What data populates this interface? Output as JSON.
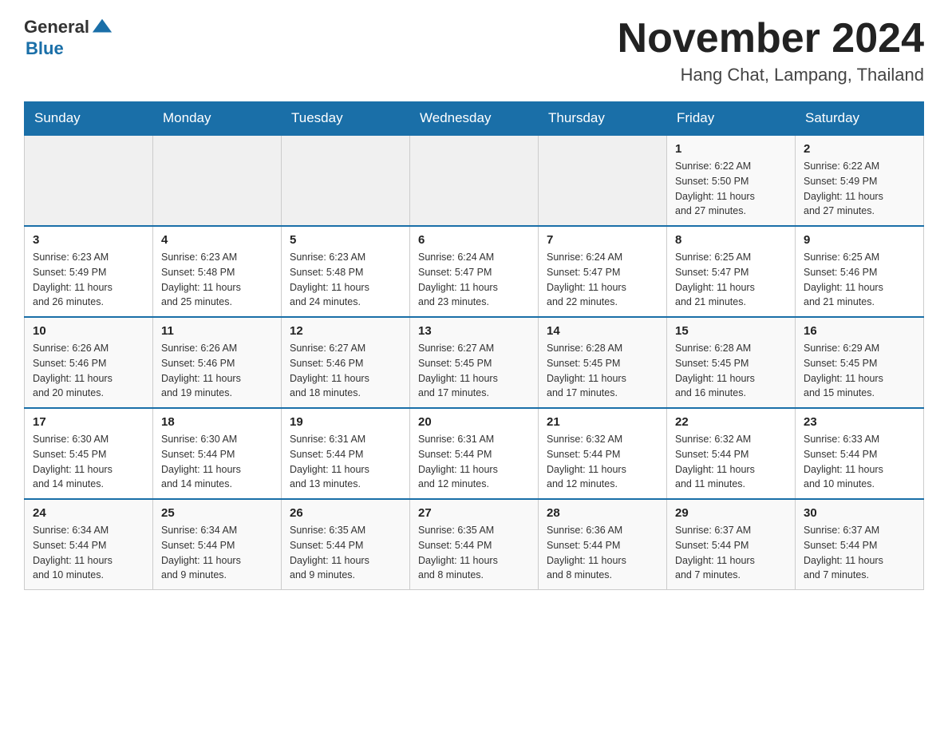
{
  "header": {
    "logo_text_general": "General",
    "logo_text_blue": "Blue",
    "month_title": "November 2024",
    "location": "Hang Chat, Lampang, Thailand"
  },
  "weekdays": [
    "Sunday",
    "Monday",
    "Tuesday",
    "Wednesday",
    "Thursday",
    "Friday",
    "Saturday"
  ],
  "weeks": [
    {
      "days": [
        {
          "num": "",
          "info": ""
        },
        {
          "num": "",
          "info": ""
        },
        {
          "num": "",
          "info": ""
        },
        {
          "num": "",
          "info": ""
        },
        {
          "num": "",
          "info": ""
        },
        {
          "num": "1",
          "info": "Sunrise: 6:22 AM\nSunset: 5:50 PM\nDaylight: 11 hours\nand 27 minutes."
        },
        {
          "num": "2",
          "info": "Sunrise: 6:22 AM\nSunset: 5:49 PM\nDaylight: 11 hours\nand 27 minutes."
        }
      ]
    },
    {
      "days": [
        {
          "num": "3",
          "info": "Sunrise: 6:23 AM\nSunset: 5:49 PM\nDaylight: 11 hours\nand 26 minutes."
        },
        {
          "num": "4",
          "info": "Sunrise: 6:23 AM\nSunset: 5:48 PM\nDaylight: 11 hours\nand 25 minutes."
        },
        {
          "num": "5",
          "info": "Sunrise: 6:23 AM\nSunset: 5:48 PM\nDaylight: 11 hours\nand 24 minutes."
        },
        {
          "num": "6",
          "info": "Sunrise: 6:24 AM\nSunset: 5:47 PM\nDaylight: 11 hours\nand 23 minutes."
        },
        {
          "num": "7",
          "info": "Sunrise: 6:24 AM\nSunset: 5:47 PM\nDaylight: 11 hours\nand 22 minutes."
        },
        {
          "num": "8",
          "info": "Sunrise: 6:25 AM\nSunset: 5:47 PM\nDaylight: 11 hours\nand 21 minutes."
        },
        {
          "num": "9",
          "info": "Sunrise: 6:25 AM\nSunset: 5:46 PM\nDaylight: 11 hours\nand 21 minutes."
        }
      ]
    },
    {
      "days": [
        {
          "num": "10",
          "info": "Sunrise: 6:26 AM\nSunset: 5:46 PM\nDaylight: 11 hours\nand 20 minutes."
        },
        {
          "num": "11",
          "info": "Sunrise: 6:26 AM\nSunset: 5:46 PM\nDaylight: 11 hours\nand 19 minutes."
        },
        {
          "num": "12",
          "info": "Sunrise: 6:27 AM\nSunset: 5:46 PM\nDaylight: 11 hours\nand 18 minutes."
        },
        {
          "num": "13",
          "info": "Sunrise: 6:27 AM\nSunset: 5:45 PM\nDaylight: 11 hours\nand 17 minutes."
        },
        {
          "num": "14",
          "info": "Sunrise: 6:28 AM\nSunset: 5:45 PM\nDaylight: 11 hours\nand 17 minutes."
        },
        {
          "num": "15",
          "info": "Sunrise: 6:28 AM\nSunset: 5:45 PM\nDaylight: 11 hours\nand 16 minutes."
        },
        {
          "num": "16",
          "info": "Sunrise: 6:29 AM\nSunset: 5:45 PM\nDaylight: 11 hours\nand 15 minutes."
        }
      ]
    },
    {
      "days": [
        {
          "num": "17",
          "info": "Sunrise: 6:30 AM\nSunset: 5:45 PM\nDaylight: 11 hours\nand 14 minutes."
        },
        {
          "num": "18",
          "info": "Sunrise: 6:30 AM\nSunset: 5:44 PM\nDaylight: 11 hours\nand 14 minutes."
        },
        {
          "num": "19",
          "info": "Sunrise: 6:31 AM\nSunset: 5:44 PM\nDaylight: 11 hours\nand 13 minutes."
        },
        {
          "num": "20",
          "info": "Sunrise: 6:31 AM\nSunset: 5:44 PM\nDaylight: 11 hours\nand 12 minutes."
        },
        {
          "num": "21",
          "info": "Sunrise: 6:32 AM\nSunset: 5:44 PM\nDaylight: 11 hours\nand 12 minutes."
        },
        {
          "num": "22",
          "info": "Sunrise: 6:32 AM\nSunset: 5:44 PM\nDaylight: 11 hours\nand 11 minutes."
        },
        {
          "num": "23",
          "info": "Sunrise: 6:33 AM\nSunset: 5:44 PM\nDaylight: 11 hours\nand 10 minutes."
        }
      ]
    },
    {
      "days": [
        {
          "num": "24",
          "info": "Sunrise: 6:34 AM\nSunset: 5:44 PM\nDaylight: 11 hours\nand 10 minutes."
        },
        {
          "num": "25",
          "info": "Sunrise: 6:34 AM\nSunset: 5:44 PM\nDaylight: 11 hours\nand 9 minutes."
        },
        {
          "num": "26",
          "info": "Sunrise: 6:35 AM\nSunset: 5:44 PM\nDaylight: 11 hours\nand 9 minutes."
        },
        {
          "num": "27",
          "info": "Sunrise: 6:35 AM\nSunset: 5:44 PM\nDaylight: 11 hours\nand 8 minutes."
        },
        {
          "num": "28",
          "info": "Sunrise: 6:36 AM\nSunset: 5:44 PM\nDaylight: 11 hours\nand 8 minutes."
        },
        {
          "num": "29",
          "info": "Sunrise: 6:37 AM\nSunset: 5:44 PM\nDaylight: 11 hours\nand 7 minutes."
        },
        {
          "num": "30",
          "info": "Sunrise: 6:37 AM\nSunset: 5:44 PM\nDaylight: 11 hours\nand 7 minutes."
        }
      ]
    }
  ]
}
